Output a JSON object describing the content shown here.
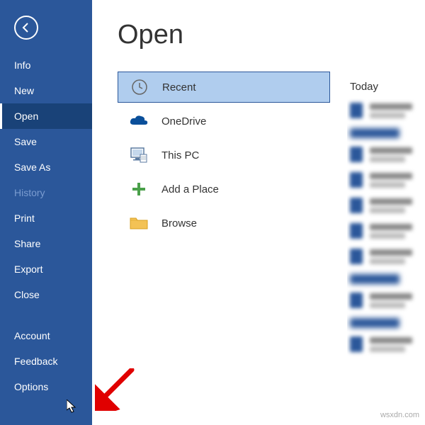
{
  "page_title": "Open",
  "sidebar": {
    "items": [
      {
        "label": "Info"
      },
      {
        "label": "New"
      },
      {
        "label": "Open"
      },
      {
        "label": "Save"
      },
      {
        "label": "Save As"
      },
      {
        "label": "History"
      },
      {
        "label": "Print"
      },
      {
        "label": "Share"
      },
      {
        "label": "Export"
      },
      {
        "label": "Close"
      },
      {
        "label": "Account"
      },
      {
        "label": "Feedback"
      },
      {
        "label": "Options"
      }
    ]
  },
  "locations": {
    "recent": "Recent",
    "onedrive": "OneDrive",
    "thispc": "This PC",
    "addplace": "Add a Place",
    "browse": "Browse"
  },
  "right": {
    "today": "Today"
  },
  "watermark": "wsxdn.com",
  "colors": {
    "brand": "#2b579a",
    "active": "#194278",
    "selected": "#b0cdee"
  }
}
